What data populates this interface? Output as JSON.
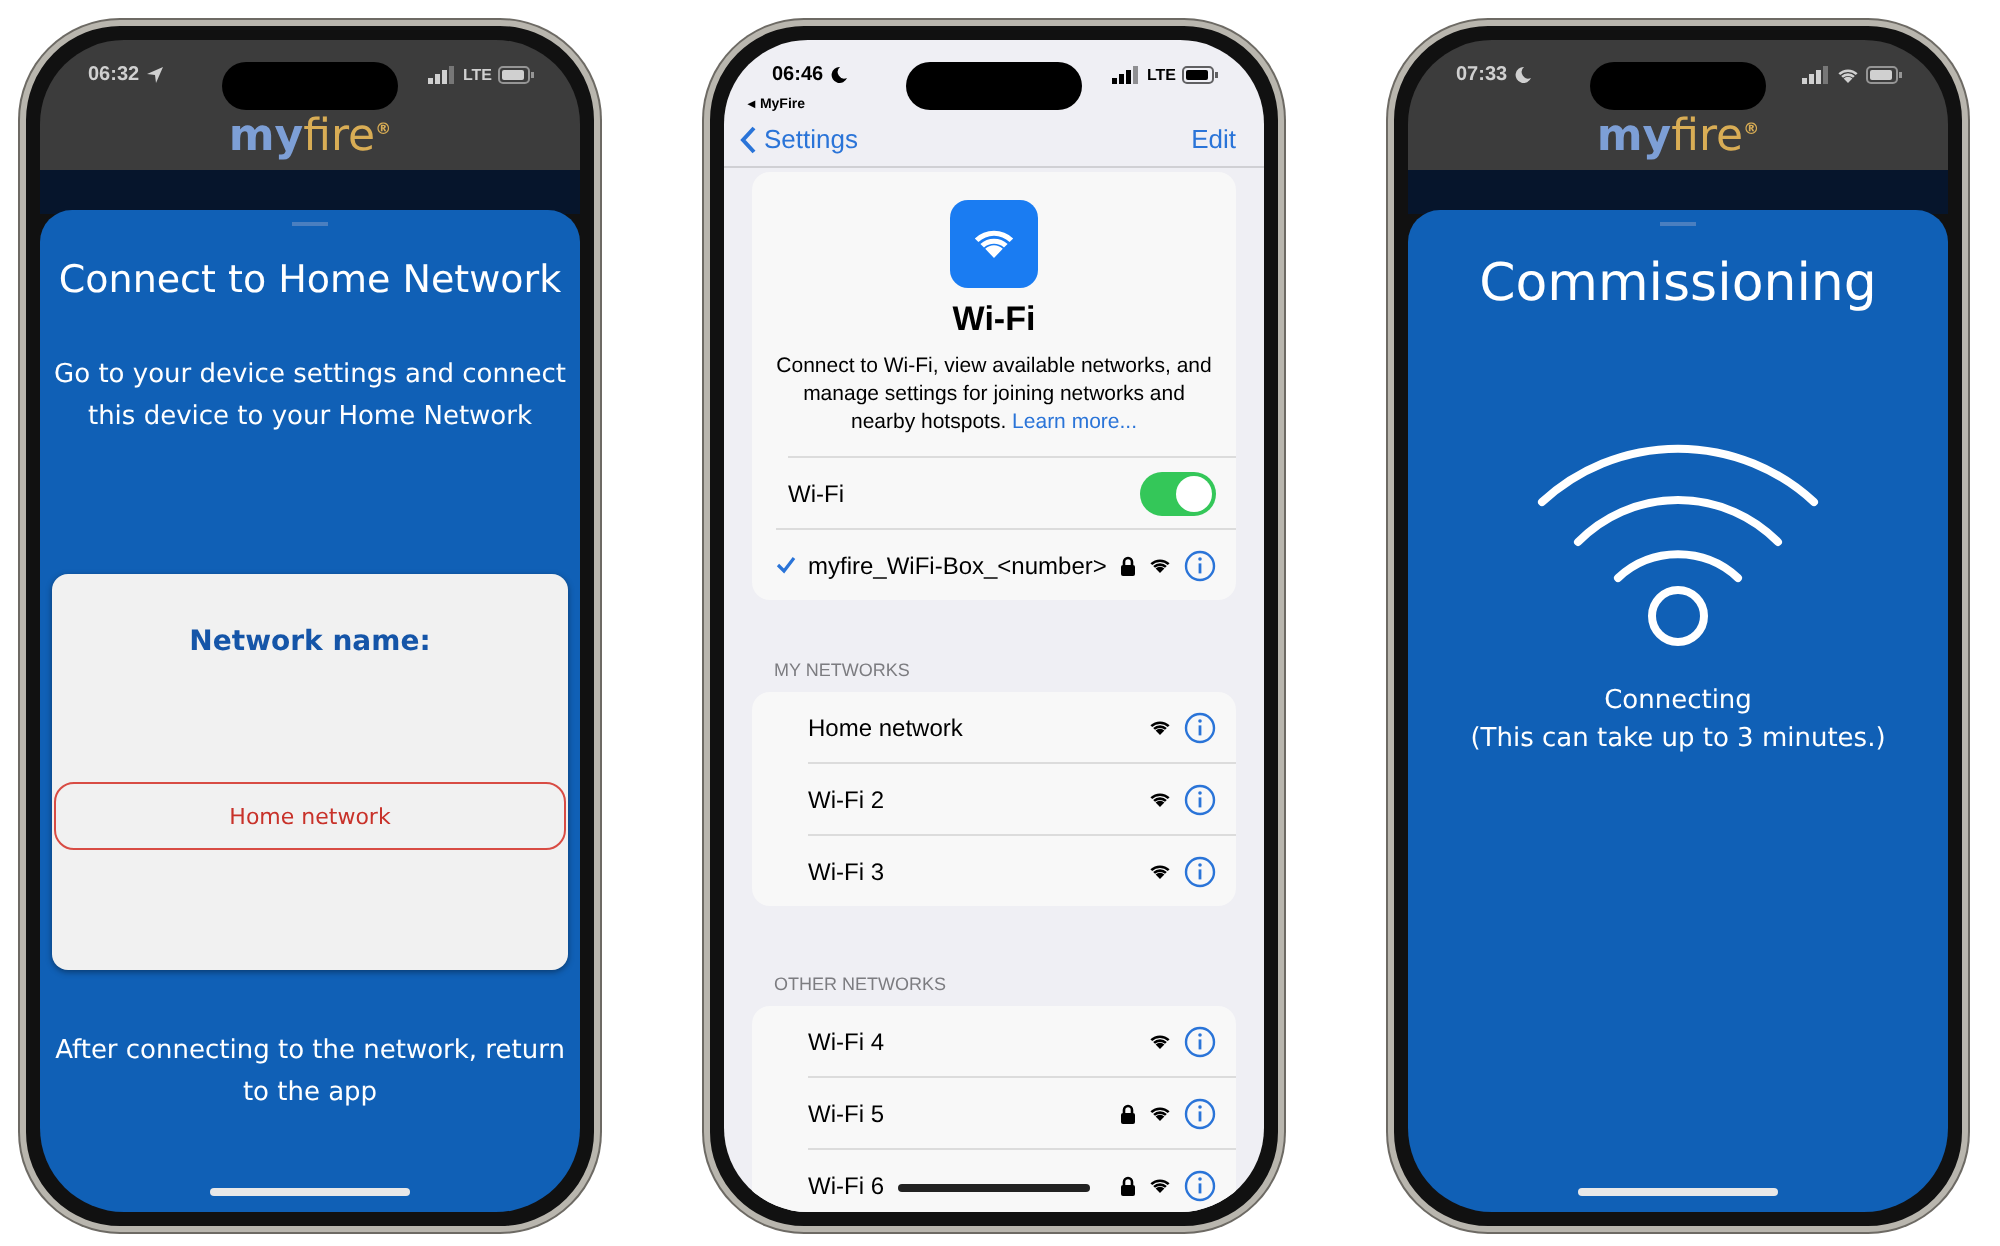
{
  "phones": [
    {
      "kind": "app_form",
      "status_bar": {
        "time": "06:32",
        "location": true,
        "focus": false,
        "wifi": false,
        "network": "LTE"
      },
      "logo": {
        "part_1": "my",
        "part_2": "fire",
        "mark": "®"
      },
      "title": "Connect to Home Network",
      "instructions": "Go to your device settings and connect this device to your Home Network",
      "card": {
        "label": "Network name:",
        "value": "Home network"
      },
      "footer": "After connecting to the network, return to the app"
    },
    {
      "kind": "settings",
      "status_bar": {
        "time": "06:46",
        "location": false,
        "focus": true,
        "wifi": false,
        "network": "LTE"
      },
      "back_app": "◂ MyFire",
      "nav": {
        "back": "Settings",
        "action": "Edit"
      },
      "header": {
        "title": "Wi-Fi",
        "description": "Connect to Wi-Fi, view available networks, and manage settings for joining networks and nearby hotspots.",
        "link": "Learn more..."
      },
      "toggle": {
        "label": "Wi-Fi",
        "on": true
      },
      "connected": {
        "name": "myfire_WiFi-Box_<number>",
        "checked": true,
        "locked": true
      },
      "sections": [
        {
          "title": "MY NETWORKS",
          "networks": [
            {
              "name": "Home network",
              "locked": false
            },
            {
              "name": "Wi-Fi 2",
              "locked": false
            },
            {
              "name": "Wi-Fi 3",
              "locked": false
            }
          ]
        },
        {
          "title": "OTHER NETWORKS",
          "networks": [
            {
              "name": "Wi-Fi 4",
              "locked": false
            },
            {
              "name": "Wi-Fi 5",
              "locked": true
            },
            {
              "name": "Wi-Fi 6",
              "locked": true
            }
          ]
        }
      ]
    },
    {
      "kind": "app_status",
      "status_bar": {
        "time": "07:33",
        "location": false,
        "focus": true,
        "wifi": true
      },
      "logo": {
        "part_1": "my",
        "part_2": "fire",
        "mark": "®"
      },
      "title": "Commissioning",
      "status": "Connecting",
      "note": "(This can take up to 3 minutes.)"
    }
  ]
}
